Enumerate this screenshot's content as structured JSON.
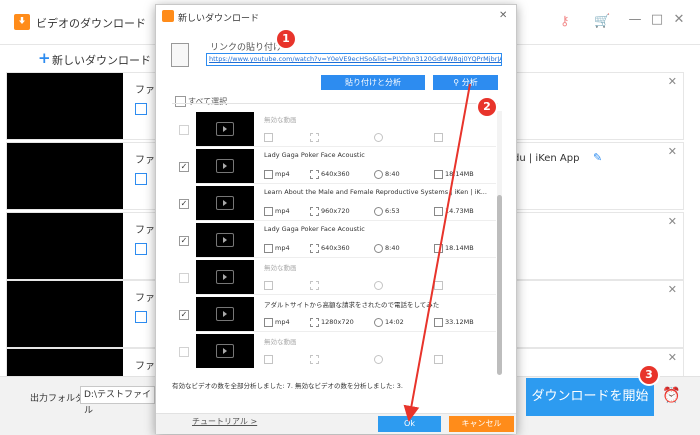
{
  "main": {
    "title": "ビデオのダウンロード",
    "new_download": "新しいダウンロード",
    "rows": [
      {
        "text": "ファ",
        "meta": ""
      },
      {
        "text": "ファ",
        "meta": "du | iKen App"
      },
      {
        "text": "ファ",
        "meta": ""
      },
      {
        "text": "ファ",
        "meta": ""
      },
      {
        "text": "ファ",
        "meta": ""
      }
    ],
    "output_label": "出力フォルダ:",
    "output_value": "D:\\テストファイル",
    "start_button": "ダウンロードを開始"
  },
  "dialog": {
    "title": "新しいダウンロード",
    "url_label": "リンクの貼り付け",
    "url_value": "https://www.youtube.com/watch?v=Y0eVE9ecHSo&list=PLYbhn3120Gdl4W8qj0YQPrMjbrJAOvnW",
    "paste_analyze_button": "貼り付けと分析",
    "analyze_button": "分析",
    "select_all": "すべて選択",
    "items": [
      {
        "name": "無効な動画",
        "format": "",
        "resolution": "",
        "duration": "",
        "size": "",
        "checked": false,
        "disabled": true
      },
      {
        "name": "Lady Gaga Poker Face Acoustic",
        "format": "mp4",
        "resolution": "640x360",
        "duration": "8:40",
        "size": "18.14MB",
        "checked": true,
        "disabled": false
      },
      {
        "name": "Learn About the Male and Female Reproductive Systems | iKen | iK...",
        "format": "mp4",
        "resolution": "960x720",
        "duration": "6:53",
        "size": "14.73MB",
        "checked": true,
        "disabled": false
      },
      {
        "name": "Lady Gaga Poker Face Acoustic",
        "format": "mp4",
        "resolution": "640x360",
        "duration": "8:40",
        "size": "18.14MB",
        "checked": true,
        "disabled": false
      },
      {
        "name": "無効な動画",
        "format": "",
        "resolution": "",
        "duration": "",
        "size": "",
        "checked": false,
        "disabled": true
      },
      {
        "name": "アダルトサイトから高額な請求をされたので電話をしてみた",
        "format": "mp4",
        "resolution": "1280x720",
        "duration": "14:02",
        "size": "33.12MB",
        "checked": true,
        "disabled": false
      },
      {
        "name": "無効な動画",
        "format": "",
        "resolution": "",
        "duration": "",
        "size": "",
        "checked": false,
        "disabled": true
      }
    ],
    "status": "有効なビデオの数を全部分析しました: 7. 無効なビデオの数を分析しました: 3.",
    "tutorial_link": "チュートリアル >",
    "ok_button": "Ok",
    "cancel_button": "キャンセル"
  },
  "badges": {
    "one": "1",
    "two": "2",
    "three": "3"
  },
  "icons": {
    "app_logo": "download-logo-icon",
    "key": "key-icon",
    "cart": "cart-icon",
    "close": "close-icon",
    "clipboard": "clipboard-icon",
    "alarm": "alarm-clock-icon"
  },
  "colors": {
    "accent": "#2d9bf0",
    "brand": "#ff8c1a",
    "badge": "#e8342b"
  }
}
